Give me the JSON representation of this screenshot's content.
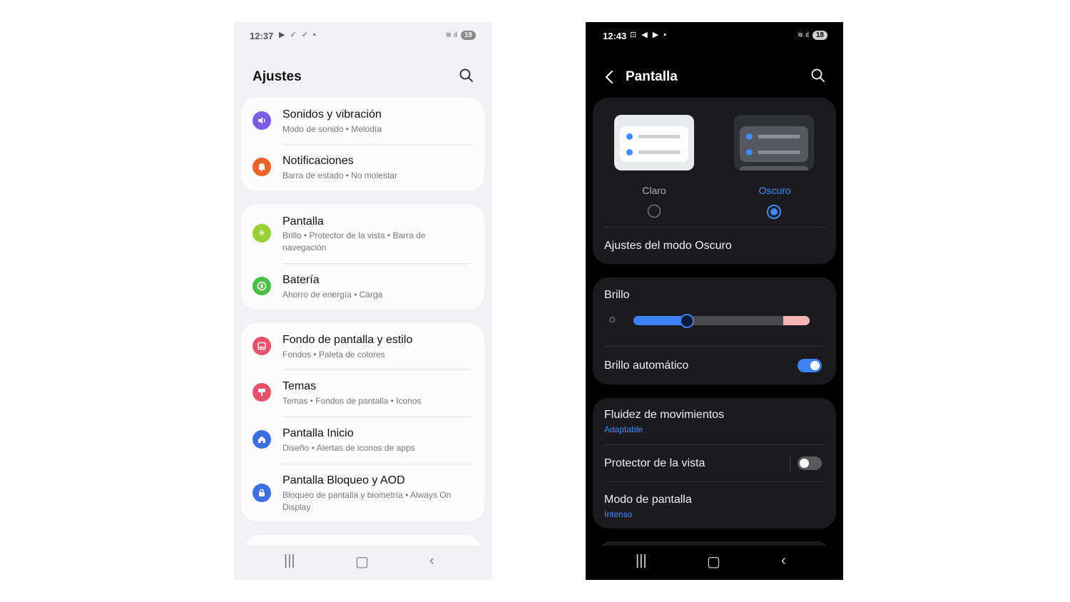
{
  "light_screen": {
    "status": {
      "time": "12:37",
      "battery": "19"
    },
    "title": "Ajustes",
    "items": [
      {
        "title": "Sonidos y vibración",
        "subtitle": "Modo de sonido  •  Melodía",
        "icon": "speaker-icon",
        "color": "#7b5ce6"
      },
      {
        "title": "Notificaciones",
        "subtitle": "Barra de estado  •  No molestar",
        "icon": "bell-icon",
        "color": "#ec6328"
      },
      {
        "title": "Pantalla",
        "subtitle": "Brillo  •  Protector de la vista  •  Barra de navegación",
        "icon": "sun-icon",
        "color": "#9ad037"
      },
      {
        "title": "Batería",
        "subtitle": "Ahorro de energía  •  Carga",
        "icon": "battery-icon",
        "color": "#4cbf4a"
      },
      {
        "title": "Fondo de pantalla y estilo",
        "subtitle": "Fondos  •  Paleta de colores",
        "icon": "image-icon",
        "color": "#e5526a"
      },
      {
        "title": "Temas",
        "subtitle": "Temas  •  Fondos de pantalla  •  Iconos",
        "icon": "paint-brush-icon",
        "color": "#e5526a"
      },
      {
        "title": "Pantalla Inicio",
        "subtitle": "Diseño  •  Alertas de iconos de apps",
        "icon": "home-icon",
        "color": "#3d6fe0"
      },
      {
        "title": "Pantalla Bloqueo y AOD",
        "subtitle": "Bloqueo de pantalla y biometría  •  Always On Display",
        "icon": "lock-icon",
        "color": "#3d6fe0"
      }
    ]
  },
  "dark_screen": {
    "status": {
      "time": "12:43",
      "battery": "18"
    },
    "title": "Pantalla",
    "theme": {
      "light_label": "Claro",
      "dark_label": "Oscuro",
      "selected": "Oscuro"
    },
    "dark_mode_settings": "Ajustes del modo Oscuro",
    "brightness": {
      "label": "Brillo",
      "level": 0.3
    },
    "auto_brightness": {
      "label": "Brillo automático",
      "on": true
    },
    "motion": {
      "label": "Fluidez de movimientos",
      "value": "Adaptable"
    },
    "eye_comfort": {
      "label": "Protector de la vista",
      "on": false
    },
    "screen_mode": {
      "label": "Modo de pantalla",
      "value": "Intenso"
    }
  },
  "colors": {
    "accent_blue": "#3f8cff",
    "slider_blue": "#3c82f6",
    "slider_pink": "#f2b5b3"
  }
}
